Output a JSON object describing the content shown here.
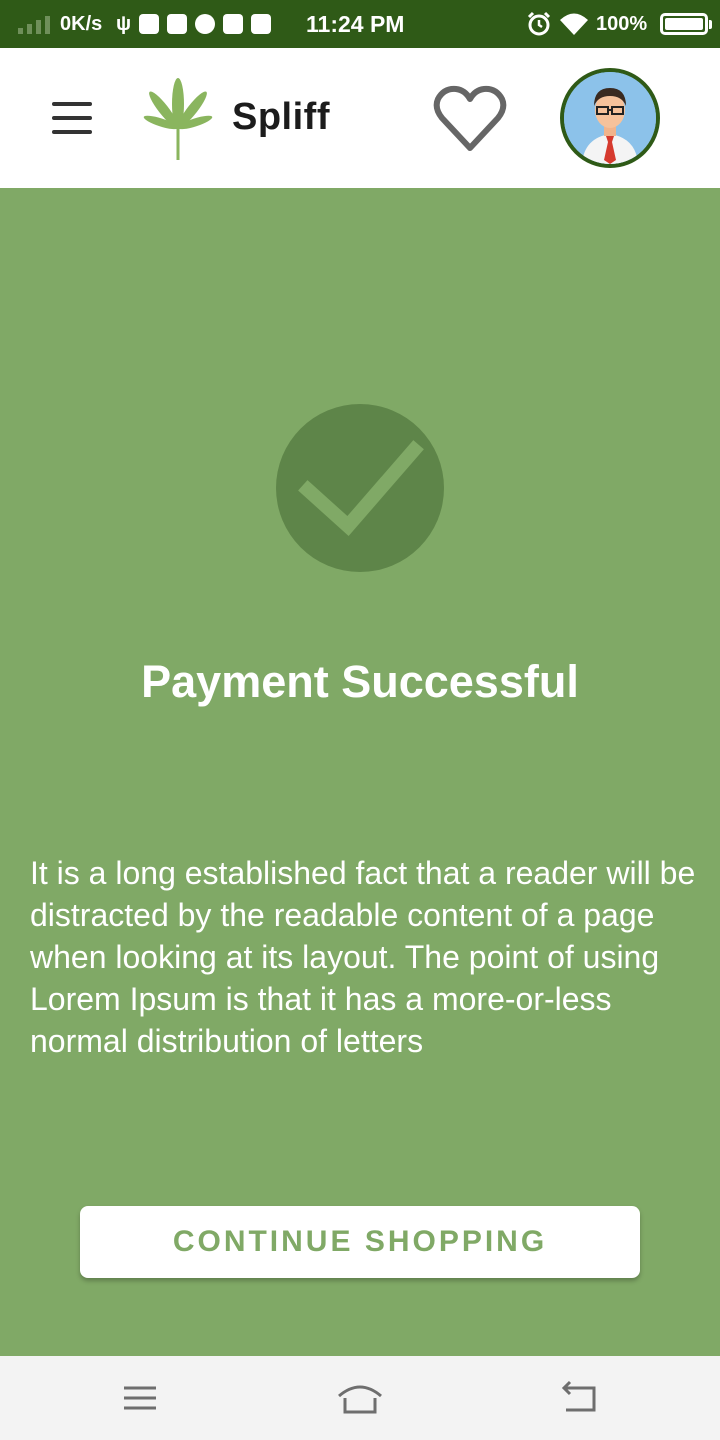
{
  "status_bar": {
    "network_speed": "0K/s",
    "time": "11:24 PM",
    "battery_percent": "100%",
    "icons": [
      "signal-icon",
      "usb-icon",
      "notification-icons",
      "alarm-icon",
      "wifi-icon",
      "battery-icon"
    ]
  },
  "app_bar": {
    "title": "Spliff",
    "icons": [
      "menu-icon",
      "cannabis-leaf-logo",
      "heart-icon",
      "profile-avatar"
    ]
  },
  "main": {
    "title": "Payment Successful",
    "message": "It is a long established fact that a reader will be distracted by the readable content of a page when looking at its layout. The point of using Lorem Ipsum is that it has a more-or-less normal distribution of letters",
    "continue_button": "CONTINUE SHOPPING",
    "icon": "check-icon"
  },
  "nav_bar": {
    "icons": [
      "recents-icon",
      "home-icon",
      "back-icon"
    ]
  },
  "colors": {
    "status_bar": "#2f5a17",
    "background": "#80a966",
    "check_circle": "#5e8549",
    "button_text": "#80a966",
    "app_bar": "#ffffff"
  }
}
